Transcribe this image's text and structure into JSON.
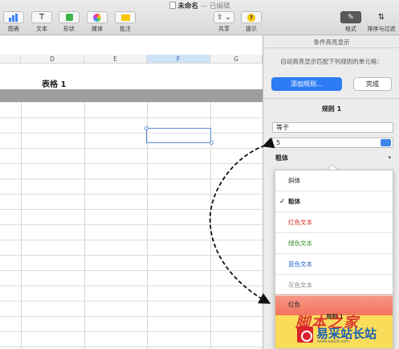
{
  "window": {
    "title": "未命名",
    "edited": "— 已编辑"
  },
  "toolbar": {
    "chart": "图表",
    "text": "文本",
    "shape": "形状",
    "media": "媒体",
    "comment": "批注",
    "share": "共享",
    "tips": "提示",
    "format": "格式",
    "sort_filter": "排序与过滤"
  },
  "sheet": {
    "columns": [
      "D",
      "E",
      "F",
      "G"
    ],
    "selected_column": "F",
    "table_title": "表格 1"
  },
  "panel": {
    "title": "条件高亮显示",
    "description": "自动高亮显示匹配下列规则的单元格：",
    "add_rule": "添加规则...",
    "done": "完成",
    "rule_title": "规则 1",
    "condition": "等于",
    "value": "5",
    "style": "粗体"
  },
  "dropdown": {
    "items": [
      {
        "label": "斜体",
        "checked": false,
        "color": "#222222"
      },
      {
        "label": "粗体",
        "checked": true,
        "color": "#222222"
      },
      {
        "label": "红色文本",
        "checked": false,
        "color": "#d62d20"
      },
      {
        "label": "绿色文本",
        "checked": false,
        "color": "#3a8f2e"
      },
      {
        "label": "蓝色文本",
        "checked": false,
        "color": "#2a62c9"
      },
      {
        "label": "灰色文本",
        "checked": false,
        "color": "#888888"
      }
    ],
    "red_fill_label": "红色",
    "overlay_label": "规则 1"
  },
  "watermark": {
    "script": "脚本之家",
    "brand": "易采站长站",
    "url": "www.easck.com"
  }
}
